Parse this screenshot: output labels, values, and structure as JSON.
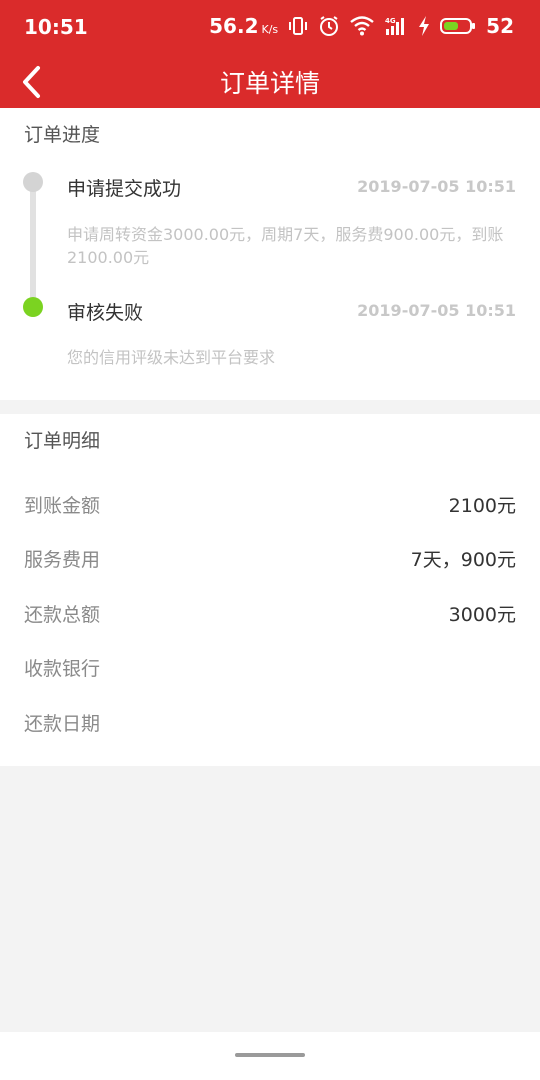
{
  "status_bar": {
    "time": "10:51",
    "net_speed": "56.2",
    "net_speed_unit": "K/s",
    "battery": "52",
    "icons": [
      "vibrate-icon",
      "alarm-icon",
      "wifi-icon",
      "signal-4g-icon",
      "charging-icon",
      "battery-icon"
    ]
  },
  "nav": {
    "title": "订单详情",
    "back_icon": "back-arrow-icon"
  },
  "progress": {
    "title": "订单进度",
    "steps": [
      {
        "title": "申请提交成功",
        "time": "2019-07-05 10:51",
        "desc": "申请周转资金3000.00元，周期7天，服务费900.00元，到账2100.00元",
        "dot_color": "#d4d4d4"
      },
      {
        "title": "审核失败",
        "time": "2019-07-05 10:51",
        "desc": "您的信用评级未达到平台要求",
        "dot_color": "#7bd321"
      }
    ]
  },
  "details": {
    "title": "订单明细",
    "rows": [
      {
        "label": "到账金额",
        "value": "2100元"
      },
      {
        "label": "服务费用",
        "value": "7天，900元"
      },
      {
        "label": "还款总额",
        "value": "3000元"
      },
      {
        "label": "收款银行",
        "value": ""
      },
      {
        "label": "还款日期",
        "value": ""
      }
    ]
  },
  "colors": {
    "brand_red": "#da2b2b",
    "success_green": "#7bd321",
    "page_bg": "#f3f3f3"
  }
}
